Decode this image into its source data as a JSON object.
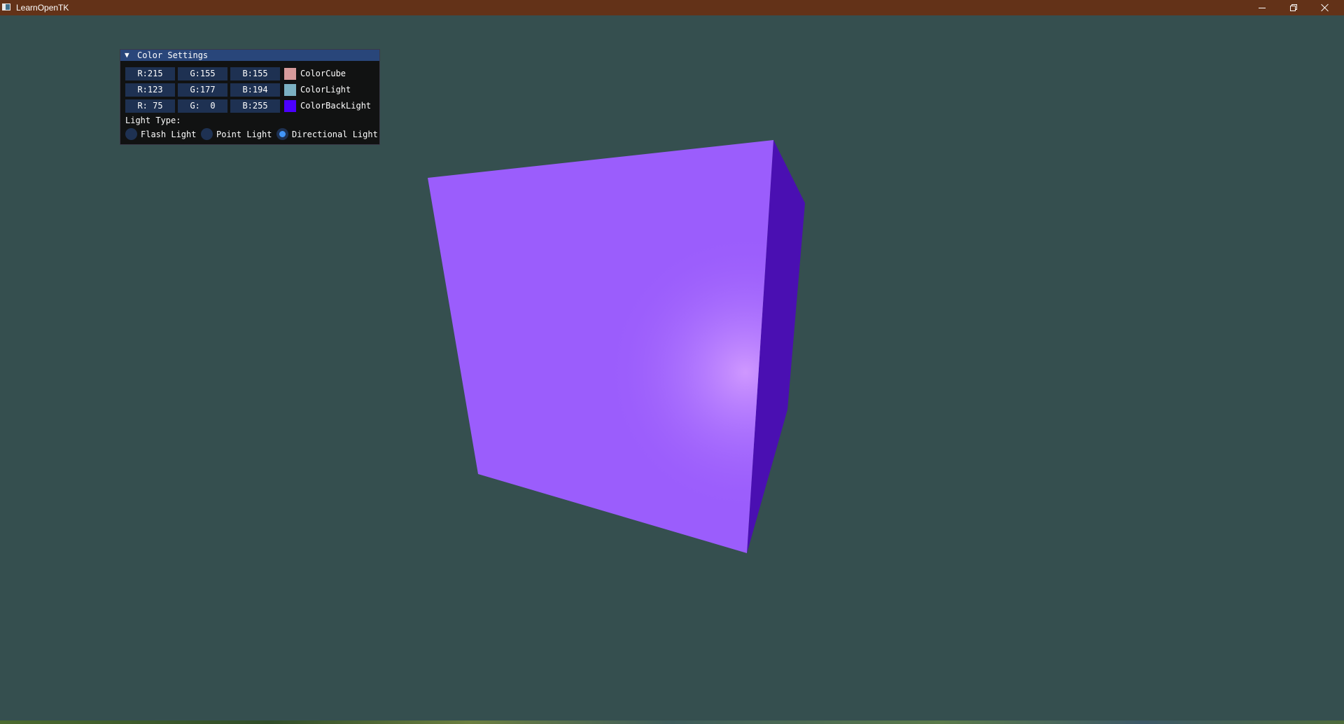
{
  "window": {
    "title": "LearnOpenTK",
    "titlebar_color": "#633218",
    "app_icon": "window-icon",
    "controls": [
      "minimize-icon",
      "restore-icon",
      "close-icon"
    ]
  },
  "viewport": {
    "background_color": "#354f4f",
    "object": "cube",
    "cube_front_color": "#9b5dfc",
    "cube_side_color": "#4a0fb2"
  },
  "color_settings": {
    "title": "Color Settings",
    "collapse_icon": "triangle-down-icon",
    "rows": [
      {
        "r": "R:215",
        "g": "G:155",
        "b": "B:155",
        "label": "ColorCube",
        "swatch": "#d79b9b"
      },
      {
        "r": "R:123",
        "g": "G:177",
        "b": "B:194",
        "label": "ColorLight",
        "swatch": "#7bb1c2"
      },
      {
        "r": "R: 75",
        "g": "G:  0",
        "b": "B:255",
        "label": "ColorBackLight",
        "swatch": "#4b00ff"
      }
    ],
    "light_type_label": "Light Type:",
    "light_types": [
      {
        "label": "Flash Light",
        "selected": false
      },
      {
        "label": "Point Light",
        "selected": false
      },
      {
        "label": "Directional Light",
        "selected": true
      }
    ]
  }
}
